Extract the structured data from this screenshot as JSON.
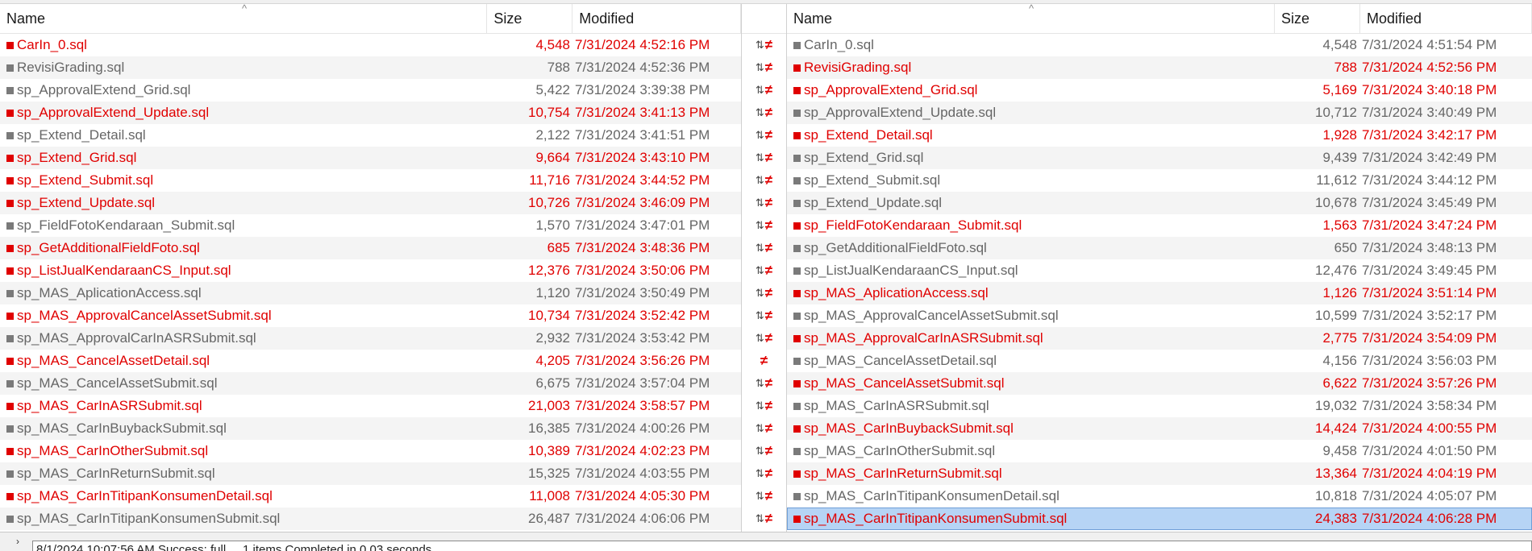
{
  "left": {
    "columns": {
      "name": "Name",
      "size": "Size",
      "modified": "Modified"
    },
    "rows": [
      {
        "name": "CarIn_0.sql",
        "size": "4,548",
        "modified": "7/31/2024 4:52:16 PM",
        "diff": true
      },
      {
        "name": "RevisiGrading.sql",
        "size": "788",
        "modified": "7/31/2024 4:52:36 PM",
        "diff": false
      },
      {
        "name": "sp_ApprovalExtend_Grid.sql",
        "size": "5,422",
        "modified": "7/31/2024 3:39:38 PM",
        "diff": false
      },
      {
        "name": "sp_ApprovalExtend_Update.sql",
        "size": "10,754",
        "modified": "7/31/2024 3:41:13 PM",
        "diff": true
      },
      {
        "name": "sp_Extend_Detail.sql",
        "size": "2,122",
        "modified": "7/31/2024 3:41:51 PM",
        "diff": false
      },
      {
        "name": "sp_Extend_Grid.sql",
        "size": "9,664",
        "modified": "7/31/2024 3:43:10 PM",
        "diff": true
      },
      {
        "name": "sp_Extend_Submit.sql",
        "size": "11,716",
        "modified": "7/31/2024 3:44:52 PM",
        "diff": true
      },
      {
        "name": "sp_Extend_Update.sql",
        "size": "10,726",
        "modified": "7/31/2024 3:46:09 PM",
        "diff": true
      },
      {
        "name": "sp_FieldFotoKendaraan_Submit.sql",
        "size": "1,570",
        "modified": "7/31/2024 3:47:01 PM",
        "diff": false
      },
      {
        "name": "sp_GetAdditionalFieldFoto.sql",
        "size": "685",
        "modified": "7/31/2024 3:48:36 PM",
        "diff": true
      },
      {
        "name": "sp_ListJualKendaraanCS_Input.sql",
        "size": "12,376",
        "modified": "7/31/2024 3:50:06 PM",
        "diff": true
      },
      {
        "name": "sp_MAS_AplicationAccess.sql",
        "size": "1,120",
        "modified": "7/31/2024 3:50:49 PM",
        "diff": false
      },
      {
        "name": "sp_MAS_ApprovalCancelAssetSubmit.sql",
        "size": "10,734",
        "modified": "7/31/2024 3:52:42 PM",
        "diff": true
      },
      {
        "name": "sp_MAS_ApprovalCarInASRSubmit.sql",
        "size": "2,932",
        "modified": "7/31/2024 3:53:42 PM",
        "diff": false
      },
      {
        "name": "sp_MAS_CancelAssetDetail.sql",
        "size": "4,205",
        "modified": "7/31/2024 3:56:26 PM",
        "diff": true
      },
      {
        "name": "sp_MAS_CancelAssetSubmit.sql",
        "size": "6,675",
        "modified": "7/31/2024 3:57:04 PM",
        "diff": false
      },
      {
        "name": "sp_MAS_CarInASRSubmit.sql",
        "size": "21,003",
        "modified": "7/31/2024 3:58:57 PM",
        "diff": true
      },
      {
        "name": "sp_MAS_CarInBuybackSubmit.sql",
        "size": "16,385",
        "modified": "7/31/2024 4:00:26 PM",
        "diff": false
      },
      {
        "name": "sp_MAS_CarInOtherSubmit.sql",
        "size": "10,389",
        "modified": "7/31/2024 4:02:23 PM",
        "diff": true
      },
      {
        "name": "sp_MAS_CarInReturnSubmit.sql",
        "size": "15,325",
        "modified": "7/31/2024 4:03:55 PM",
        "diff": false
      },
      {
        "name": "sp_MAS_CarInTitipanKonsumenDetail.sql",
        "size": "11,008",
        "modified": "7/31/2024 4:05:30 PM",
        "diff": true
      },
      {
        "name": "sp_MAS_CarInTitipanKonsumenSubmit.sql",
        "size": "26,487",
        "modified": "7/31/2024 4:06:06 PM",
        "diff": false
      }
    ]
  },
  "right": {
    "columns": {
      "name": "Name",
      "size": "Size",
      "modified": "Modified"
    },
    "rows": [
      {
        "name": "CarIn_0.sql",
        "size": "4,548",
        "modified": "7/31/2024 4:51:54 PM",
        "diff": false
      },
      {
        "name": "RevisiGrading.sql",
        "size": "788",
        "modified": "7/31/2024 4:52:56 PM",
        "diff": true
      },
      {
        "name": "sp_ApprovalExtend_Grid.sql",
        "size": "5,169",
        "modified": "7/31/2024 3:40:18 PM",
        "diff": true
      },
      {
        "name": "sp_ApprovalExtend_Update.sql",
        "size": "10,712",
        "modified": "7/31/2024 3:40:49 PM",
        "diff": false
      },
      {
        "name": "sp_Extend_Detail.sql",
        "size": "1,928",
        "modified": "7/31/2024 3:42:17 PM",
        "diff": true
      },
      {
        "name": "sp_Extend_Grid.sql",
        "size": "9,439",
        "modified": "7/31/2024 3:42:49 PM",
        "diff": false
      },
      {
        "name": "sp_Extend_Submit.sql",
        "size": "11,612",
        "modified": "7/31/2024 3:44:12 PM",
        "diff": false
      },
      {
        "name": "sp_Extend_Update.sql",
        "size": "10,678",
        "modified": "7/31/2024 3:45:49 PM",
        "diff": false
      },
      {
        "name": "sp_FieldFotoKendaraan_Submit.sql",
        "size": "1,563",
        "modified": "7/31/2024 3:47:24 PM",
        "diff": true
      },
      {
        "name": "sp_GetAdditionalFieldFoto.sql",
        "size": "650",
        "modified": "7/31/2024 3:48:13 PM",
        "diff": false
      },
      {
        "name": "sp_ListJualKendaraanCS_Input.sql",
        "size": "12,476",
        "modified": "7/31/2024 3:49:45 PM",
        "diff": false
      },
      {
        "name": "sp_MAS_AplicationAccess.sql",
        "size": "1,126",
        "modified": "7/31/2024 3:51:14 PM",
        "diff": true
      },
      {
        "name": "sp_MAS_ApprovalCancelAssetSubmit.sql",
        "size": "10,599",
        "modified": "7/31/2024 3:52:17 PM",
        "diff": false
      },
      {
        "name": "sp_MAS_ApprovalCarInASRSubmit.sql",
        "size": "2,775",
        "modified": "7/31/2024 3:54:09 PM",
        "diff": true
      },
      {
        "name": "sp_MAS_CancelAssetDetail.sql",
        "size": "4,156",
        "modified": "7/31/2024 3:56:03 PM",
        "diff": false
      },
      {
        "name": "sp_MAS_CancelAssetSubmit.sql",
        "size": "6,622",
        "modified": "7/31/2024 3:57:26 PM",
        "diff": true
      },
      {
        "name": "sp_MAS_CarInASRSubmit.sql",
        "size": "19,032",
        "modified": "7/31/2024 3:58:34 PM",
        "diff": false
      },
      {
        "name": "sp_MAS_CarInBuybackSubmit.sql",
        "size": "14,424",
        "modified": "7/31/2024 4:00:55 PM",
        "diff": true
      },
      {
        "name": "sp_MAS_CarInOtherSubmit.sql",
        "size": "9,458",
        "modified": "7/31/2024 4:01:50 PM",
        "diff": false
      },
      {
        "name": "sp_MAS_CarInReturnSubmit.sql",
        "size": "13,364",
        "modified": "7/31/2024 4:04:19 PM",
        "diff": true
      },
      {
        "name": "sp_MAS_CarInTitipanKonsumenDetail.sql",
        "size": "10,818",
        "modified": "7/31/2024 4:05:07 PM",
        "diff": false
      },
      {
        "name": "sp_MAS_CarInTitipanKonsumenSubmit.sql",
        "size": "24,383",
        "modified": "7/31/2024 4:06:28 PM",
        "diff": true,
        "selected": true
      }
    ]
  },
  "gutter": {
    "icons": [
      "swap-ne",
      "swap-ne",
      "swap-ne",
      "swap-ne",
      "swap-ne",
      "swap-ne",
      "swap-ne",
      "swap-ne",
      "swap-ne",
      "swap-ne",
      "swap-ne",
      "swap-ne",
      "swap-ne",
      "swap-ne",
      "ne",
      "swap-ne",
      "swap-ne",
      "swap-ne",
      "swap-ne",
      "swap-ne",
      "swap-ne",
      "swap-ne"
    ]
  },
  "status": {
    "log": "8/1/2024 10:07:56 AM  Success: full ... 1 items  Completed in 0.03 seconds"
  },
  "colors": {
    "diff": "#e00000",
    "same": "#666666",
    "selected": "#b6d4f5"
  }
}
